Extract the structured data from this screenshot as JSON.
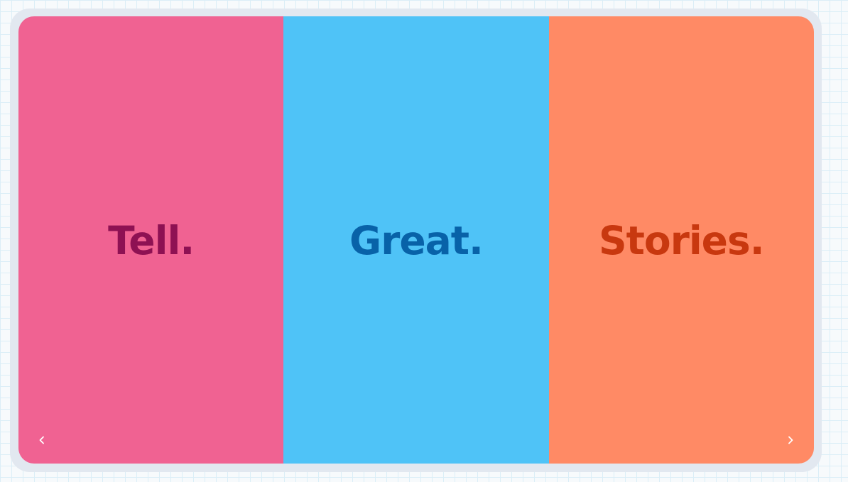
{
  "carousel": {
    "panels": [
      {
        "word": "Tell.",
        "background": "#f06292",
        "text_color": "#8e1153"
      },
      {
        "word": "Great.",
        "background": "#4fc3f7",
        "text_color": "#0862a8"
      },
      {
        "word": "Stories.",
        "background": "#ff8a65",
        "text_color": "#c8380f"
      }
    ],
    "nav": {
      "prev_icon": "chevron-left-icon",
      "next_icon": "chevron-right-icon",
      "icon_color": "#ffffff"
    }
  }
}
